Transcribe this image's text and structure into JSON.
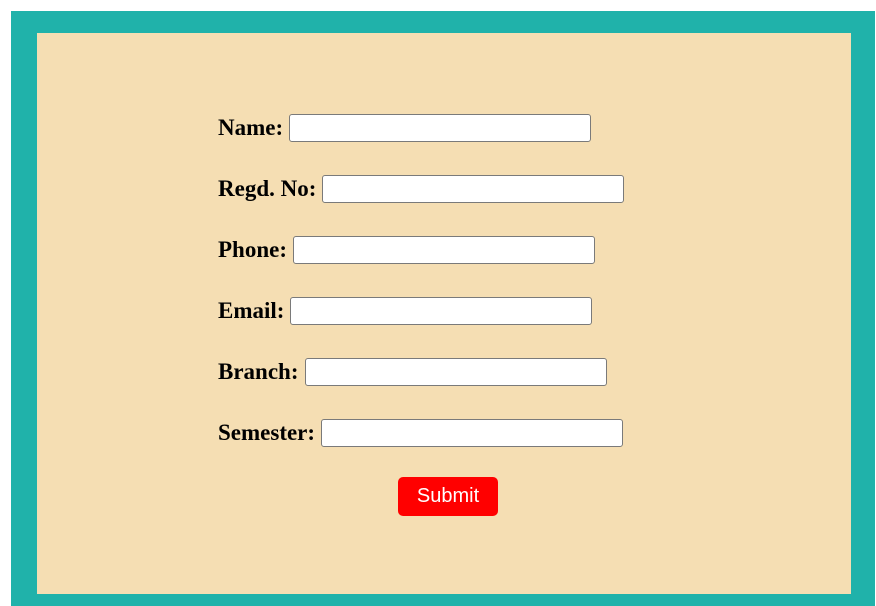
{
  "form": {
    "fields": [
      {
        "label": "Name:",
        "value": "",
        "placeholder": ""
      },
      {
        "label": "Regd. No:",
        "value": "",
        "placeholder": ""
      },
      {
        "label": "Phone:",
        "value": "",
        "placeholder": ""
      },
      {
        "label": "Email:",
        "value": "",
        "placeholder": ""
      },
      {
        "label": "Branch:",
        "value": "",
        "placeholder": ""
      },
      {
        "label": "Semester:",
        "value": "",
        "placeholder": ""
      }
    ],
    "submit_label": "Submit"
  },
  "colors": {
    "frame": "#20b2aa",
    "panel": "#f5deb3",
    "submit": "#ff0000"
  }
}
